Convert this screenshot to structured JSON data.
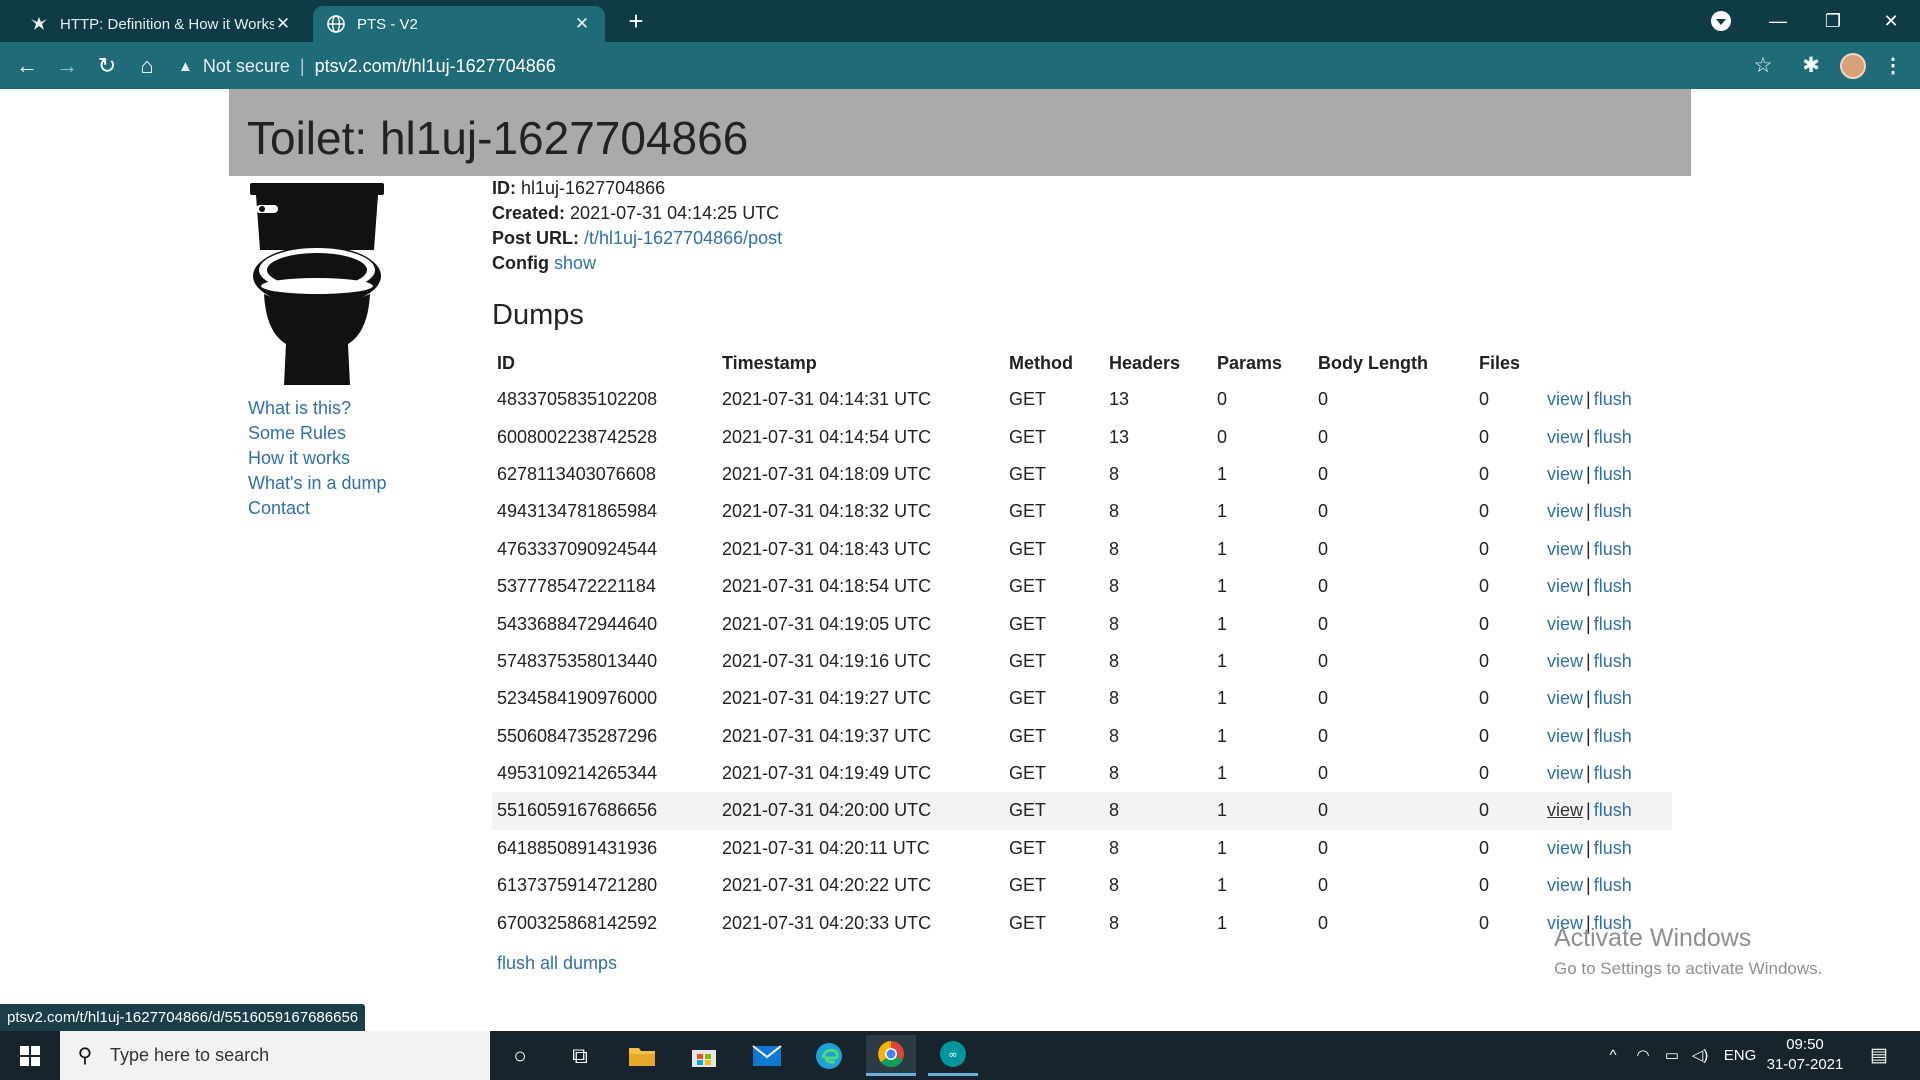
{
  "browser": {
    "tabs": [
      {
        "title": "HTTP: Definition & How it Works",
        "active": false
      },
      {
        "title": "PTS - V2",
        "active": true
      }
    ],
    "address": {
      "security": "Not secure",
      "url": "ptsv2.com/t/hl1uj-1627704866"
    },
    "status_url": "ptsv2.com/t/hl1uj-1627704866/d/5516059167686656"
  },
  "page": {
    "heading": "Toilet: hl1uj-1627704866",
    "nav": [
      "What is this?",
      "Some Rules",
      "How it works",
      "What's in a dump",
      "Contact"
    ],
    "meta": {
      "id_label": "ID:",
      "id_value": "hl1uj-1627704866",
      "created_label": "Created:",
      "created_value": "2021-07-31 04:14:25 UTC",
      "post_label": "Post URL:",
      "post_value": "/t/hl1uj-1627704866/post",
      "config_label": "Config",
      "config_link": "show"
    },
    "dumps_title": "Dumps",
    "columns": [
      "ID",
      "Timestamp",
      "Method",
      "Headers",
      "Params",
      "Body Length",
      "Files"
    ],
    "rows": [
      {
        "id": "4833705835102208",
        "timestamp": "2021-07-31 04:14:31 UTC",
        "method": "GET",
        "headers": "13",
        "params": "0",
        "body_length": "0",
        "files": "0"
      },
      {
        "id": "6008002238742528",
        "timestamp": "2021-07-31 04:14:54 UTC",
        "method": "GET",
        "headers": "13",
        "params": "0",
        "body_length": "0",
        "files": "0"
      },
      {
        "id": "6278113403076608",
        "timestamp": "2021-07-31 04:18:09 UTC",
        "method": "GET",
        "headers": "8",
        "params": "1",
        "body_length": "0",
        "files": "0"
      },
      {
        "id": "4943134781865984",
        "timestamp": "2021-07-31 04:18:32 UTC",
        "method": "GET",
        "headers": "8",
        "params": "1",
        "body_length": "0",
        "files": "0"
      },
      {
        "id": "4763337090924544",
        "timestamp": "2021-07-31 04:18:43 UTC",
        "method": "GET",
        "headers": "8",
        "params": "1",
        "body_length": "0",
        "files": "0"
      },
      {
        "id": "5377785472221184",
        "timestamp": "2021-07-31 04:18:54 UTC",
        "method": "GET",
        "headers": "8",
        "params": "1",
        "body_length": "0",
        "files": "0"
      },
      {
        "id": "5433688472944640",
        "timestamp": "2021-07-31 04:19:05 UTC",
        "method": "GET",
        "headers": "8",
        "params": "1",
        "body_length": "0",
        "files": "0"
      },
      {
        "id": "5748375358013440",
        "timestamp": "2021-07-31 04:19:16 UTC",
        "method": "GET",
        "headers": "8",
        "params": "1",
        "body_length": "0",
        "files": "0"
      },
      {
        "id": "5234584190976000",
        "timestamp": "2021-07-31 04:19:27 UTC",
        "method": "GET",
        "headers": "8",
        "params": "1",
        "body_length": "0",
        "files": "0"
      },
      {
        "id": "5506084735287296",
        "timestamp": "2021-07-31 04:19:37 UTC",
        "method": "GET",
        "headers": "8",
        "params": "1",
        "body_length": "0",
        "files": "0"
      },
      {
        "id": "4953109214265344",
        "timestamp": "2021-07-31 04:19:49 UTC",
        "method": "GET",
        "headers": "8",
        "params": "1",
        "body_length": "0",
        "files": "0"
      },
      {
        "id": "5516059167686656",
        "timestamp": "2021-07-31 04:20:00 UTC",
        "method": "GET",
        "headers": "8",
        "params": "1",
        "body_length": "0",
        "files": "0",
        "highlighted": true
      },
      {
        "id": "6418850891431936",
        "timestamp": "2021-07-31 04:20:11 UTC",
        "method": "GET",
        "headers": "8",
        "params": "1",
        "body_length": "0",
        "files": "0"
      },
      {
        "id": "6137375914721280",
        "timestamp": "2021-07-31 04:20:22 UTC",
        "method": "GET",
        "headers": "8",
        "params": "1",
        "body_length": "0",
        "files": "0"
      },
      {
        "id": "6700325868142592",
        "timestamp": "2021-07-31 04:20:33 UTC",
        "method": "GET",
        "headers": "8",
        "params": "1",
        "body_length": "0",
        "files": "0"
      }
    ],
    "row_actions": {
      "view": "view",
      "separator": "|",
      "flush": "flush"
    },
    "flush_all": "flush all dumps"
  },
  "watermark": {
    "line1": "Activate Windows",
    "line2": "Go to Settings to activate Windows."
  },
  "taskbar": {
    "search_placeholder": "Type here to search",
    "language": "ENG",
    "time": "09:50",
    "date": "31-07-2021"
  },
  "colors": {
    "chrome_dark": "#0e3b45",
    "chrome_toolbar": "#1f6b78",
    "link": "#2f6fad",
    "banner": "#aaaaaa",
    "taskbar": "#17242c"
  }
}
